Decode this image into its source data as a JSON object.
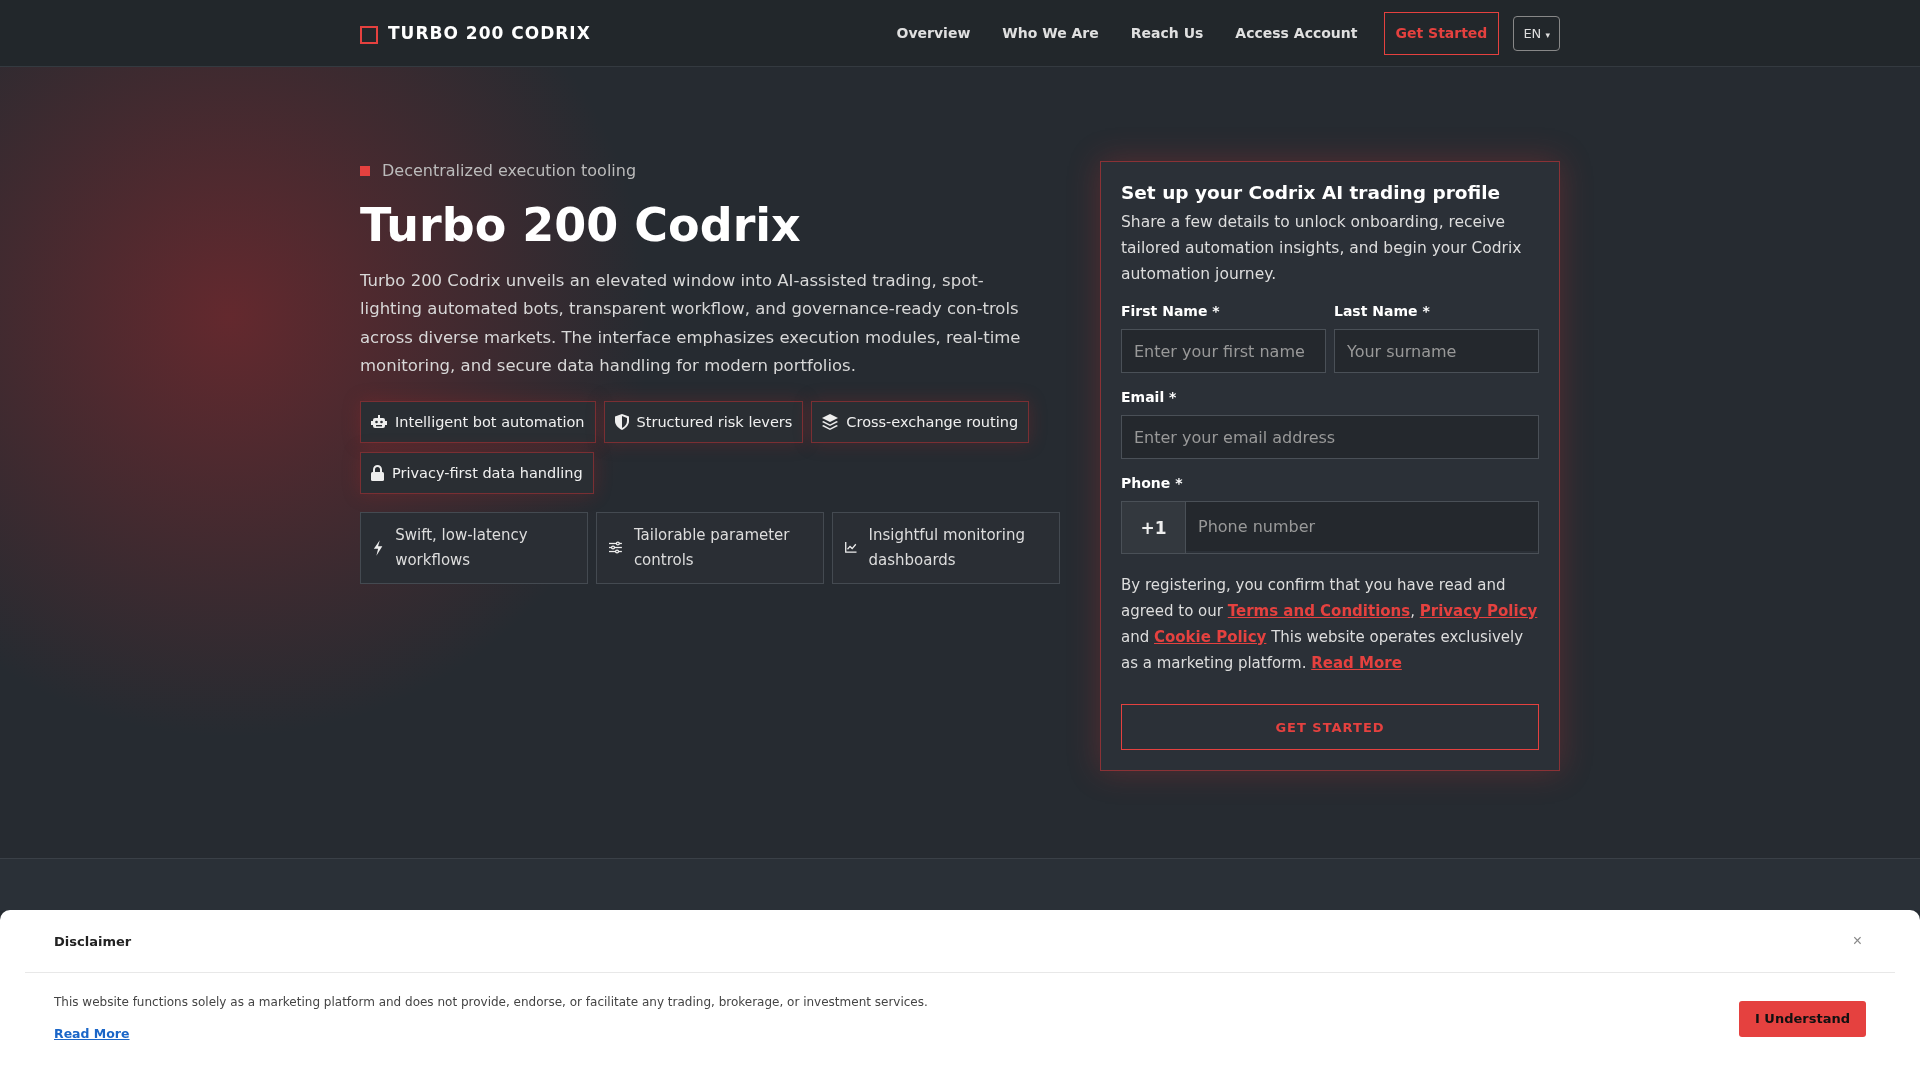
{
  "header": {
    "brand": "TURBO 200 CODRIX",
    "nav": [
      "Overview",
      "Who We Are",
      "Reach Us",
      "Access Account"
    ],
    "cta": "Get Started",
    "language": "EN",
    "language_caret": "▾"
  },
  "hero": {
    "eyebrow": "Decentralized execution tooling",
    "title": "Turbo 200 Codrix",
    "description": "Turbo 200 Codrix unveils an elevated window into AI-assisted trading, spot-lighting automated bots, transparent workflow, and governance-ready con-trols across diverse markets. The interface emphasizes execution modules, real-time monitoring, and secure data handling for modern portfolios.",
    "chips": [
      {
        "kind": "robot",
        "label": "Intelligent bot automation"
      },
      {
        "kind": "shield",
        "label": "Structured risk levers"
      },
      {
        "kind": "layers",
        "label": "Cross-exchange routing"
      },
      {
        "kind": "lock",
        "label": "Privacy-first data handling"
      }
    ],
    "features": [
      {
        "kind": "bolt",
        "label": "Swift, low-latency workflows"
      },
      {
        "kind": "sliders",
        "label": "Tailorable parameter controls"
      },
      {
        "kind": "chart",
        "label": "Insightful monitoring dashboards"
      }
    ]
  },
  "form": {
    "title": "Set up your Codrix AI trading profile",
    "intro": "Share a few details to unlock onboarding, receive tailored automation insights, and begin your Codrix automation journey.",
    "first_name": {
      "label": "First Name *",
      "placeholder": "Enter your first name"
    },
    "last_name": {
      "label": "Last Name *",
      "placeholder": "Your surname"
    },
    "email": {
      "label": "Email *",
      "placeholder": "Enter your email address"
    },
    "phone": {
      "label": "Phone *",
      "prefix": "+1",
      "placeholder": "Phone number"
    },
    "legal": [
      {
        "kind": "text",
        "text": "By registering, you confirm that you have read and agreed to our "
      },
      {
        "kind": "link",
        "text": "Terms and Conditions"
      },
      {
        "kind": "text",
        "text": ", "
      },
      {
        "kind": "link",
        "text": "Privacy Policy"
      },
      {
        "kind": "text",
        "text": " and "
      },
      {
        "kind": "link",
        "text": "Cookie Policy"
      },
      {
        "kind": "text",
        "text": " This website operates exclusively as a marketing platform. "
      },
      {
        "kind": "link",
        "text": "Read More"
      }
    ],
    "submit": "GET STARTED"
  },
  "disclaimer": {
    "title": "Disclaimer",
    "close": "×",
    "text": "This website functions solely as a marketing platform and does not provide, endorse, or facilitate any trading, brokerage, or investment services.",
    "link": "Read More",
    "button": "I Understand"
  }
}
